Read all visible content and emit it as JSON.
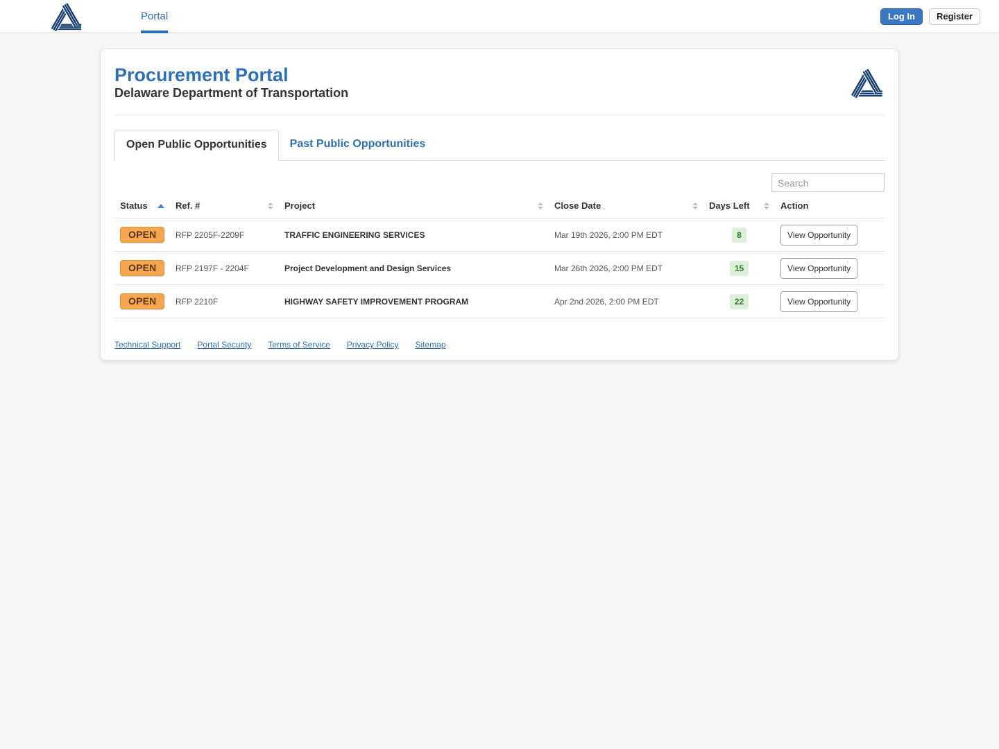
{
  "navbar": {
    "portal_label": "Portal",
    "login_label": "Log In",
    "register_label": "Register"
  },
  "header": {
    "title": "Procurement Portal",
    "subtitle": "Delaware Department of Transportation"
  },
  "tabs": [
    {
      "label": "Open Public Opportunities",
      "active": true
    },
    {
      "label": "Past Public Opportunities",
      "active": false
    }
  ],
  "search": {
    "placeholder": "Search"
  },
  "table": {
    "columns": [
      "Status",
      "Ref. #",
      "Project",
      "Close Date",
      "Days Left",
      "Action"
    ],
    "sort": {
      "column": "Status",
      "direction": "asc"
    },
    "rows": [
      {
        "status": "OPEN",
        "ref": "RFP 2205F-2209F",
        "project": "TRAFFIC ENGINEERING SERVICES",
        "close_date": "Mar 19th 2026, 2:00 PM EDT",
        "days_left": "8",
        "action": "View Opportunity"
      },
      {
        "status": "OPEN",
        "ref": "RFP 2197F - 2204F",
        "project": "Project Development and Design Services",
        "close_date": "Mar 26th 2026, 2:00 PM EDT",
        "days_left": "15",
        "action": "View Opportunity"
      },
      {
        "status": "OPEN",
        "ref": "RFP 2210F",
        "project": "HIGHWAY SAFETY IMPROVEMENT PROGRAM",
        "close_date": "Apr 2nd 2026, 2:00 PM EDT",
        "days_left": "22",
        "action": "View Opportunity"
      }
    ]
  },
  "footer": {
    "links": [
      "Technical Support",
      "Portal Security",
      "Terms of Service",
      "Privacy Policy",
      "Sitemap"
    ]
  },
  "colors": {
    "accent_blue": "#2d70b5",
    "button_blue": "#3c77c5",
    "badge_orange": "#f5a74f",
    "badge_green_bg": "#ddefd9",
    "badge_green_text": "#2c7a2c",
    "logo_navy": "#173e6e"
  }
}
